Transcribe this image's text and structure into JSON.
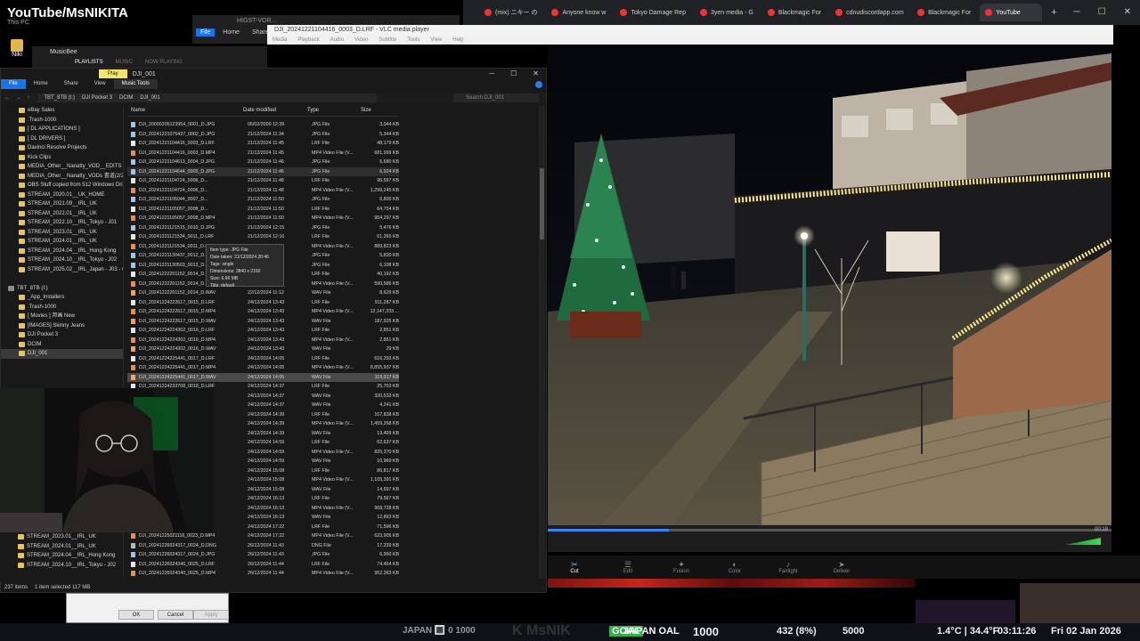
{
  "overlay": {
    "title": "YouTube/MsNIKITA",
    "this_pc": "This PC",
    "desktop_icon_label": "Niki"
  },
  "browser": {
    "tabs": [
      {
        "label": "(mix) ニキー の"
      },
      {
        "label": "Anyone know w"
      },
      {
        "label": "Tokyo Damage Rep"
      },
      {
        "label": "3yen media - G"
      },
      {
        "label": "Blackmagic For"
      },
      {
        "label": "cdnudiscordapp.com"
      },
      {
        "label": "Blackmagic For"
      },
      {
        "label": "YouTube",
        "active": true
      }
    ],
    "new_tab": "+"
  },
  "vlc": {
    "title": "DJI_20241221104416_0003_D.LRF - VLC media player",
    "menu": [
      "Media",
      "Playback",
      "Audio",
      "Video",
      "Subtitle",
      "Tools",
      "View",
      "Help"
    ],
    "time": "00:18",
    "progress": 0.215
  },
  "resolve_pages": [
    {
      "label": "Cut",
      "icon": "✂",
      "active": true
    },
    {
      "label": "Edit",
      "icon": "☰"
    },
    {
      "label": "Fusion",
      "icon": "✦"
    },
    {
      "label": "Color",
      "icon": "◐"
    },
    {
      "label": "Fairlight",
      "icon": "♪"
    },
    {
      "label": "Deliver",
      "icon": "➤"
    }
  ],
  "musicbee": {
    "title": "MusicBee",
    "tabs": [
      "PLAYLISTS",
      "MUSIC",
      "NOW PLAYING"
    ]
  },
  "bg_explorer": {
    "title": "HIGST-VOR...",
    "ribbon": [
      "File",
      "Home",
      "Share"
    ]
  },
  "explorer": {
    "play_tab": "Play",
    "title": "DJI_001",
    "ribbon": [
      "File",
      "Home",
      "Share",
      "View",
      "Music Tools"
    ],
    "path": [
      "TBT_8TB (I:)",
      "DJI Pocket 3",
      "DCIM",
      "DJI_001"
    ],
    "search_placeholder": "Search DJI_001",
    "columns": {
      "name": "Name",
      "date": "Date modified",
      "type": "Type",
      "size": "Size"
    },
    "sidebar": [
      {
        "label": "eBay Sales"
      },
      {
        "label": ".Trash-1000"
      },
      {
        "label": "[ DL APPLICATIONS ]"
      },
      {
        "label": "[ DL DRIVERS ]"
      },
      {
        "label": "Davinci Resolve Projects"
      },
      {
        "label": "Kick Clips"
      },
      {
        "label": "MEDIA_Other__Nanatty_VOD__EDITS"
      },
      {
        "label": "MEDIA_Other__Nanatty_VODs 書道(2/2"
      },
      {
        "label": "OBS Stuff copied from 512 Windows Dri"
      },
      {
        "label": "STREAM_2020.01__UK_HOME"
      },
      {
        "label": "STREAM_2021.09__IRL_UK"
      },
      {
        "label": "STREAM_2022.01__IRL_UK"
      },
      {
        "label": "STREAM_2022.10__IRL_Tokyo - J01"
      },
      {
        "label": "STREAM_2023.01__IRL_UK"
      },
      {
        "label": "STREAM_2024.01__IRL_UK"
      },
      {
        "label": "STREAM_2024.04__IRL_Hong Kong"
      },
      {
        "label": "STREAM_2024.10__IRL_Tokyo - J02"
      },
      {
        "label": "STREAM_2025.02__IRL_Japan - J03 - Co"
      },
      {
        "label": ""
      },
      {
        "label": "TBT_8TB (I:)",
        "drive": true
      },
      {
        "label": "_App_Installers"
      },
      {
        "label": ".Trash-1000"
      },
      {
        "label": "[ Movies ] 邦画 New"
      },
      {
        "label": "[IMAGES] Skinny Jeans"
      },
      {
        "label": "DJI Pocket 3"
      },
      {
        "label": "DCIM"
      },
      {
        "label": "DJI_001",
        "selected": true
      }
    ],
    "sidebar_bottom": [
      {
        "label": "STREAM_2023.01__IRL_UK"
      },
      {
        "label": "STREAM_2024.01__IRL_UK"
      },
      {
        "label": "STREAM_2024.04__IRL_Hong Kong"
      },
      {
        "label": "STREAM_2024.10__IRL_Tokyo - J02"
      }
    ],
    "files": [
      {
        "name": "DJI_20000205123954_0001_D.JPG",
        "date": "05/02/2000 12:39",
        "type": "JPG File",
        "size": "3,044 KB",
        "kind": "jpg"
      },
      {
        "name": "DJI_20241221075437_0002_D.JPG",
        "date": "21/12/2024 11:34",
        "type": "JPG File",
        "size": "5,344 KB",
        "kind": "jpg"
      },
      {
        "name": "DJI_20241221104416_0003_D.LRF",
        "date": "21/12/2024 11:45",
        "type": "LRF File",
        "size": "48,179 KB",
        "kind": "lrf"
      },
      {
        "name": "DJI_20241221104416_0003_D.MP4",
        "date": "21/12/2024 11:45",
        "type": "MP4 Video File (V...",
        "size": "681,999 KB",
        "kind": "mp4"
      },
      {
        "name": "DJI_20241221104613_0004_D.JPG",
        "date": "21/12/2024 11:46",
        "type": "JPG File",
        "size": "6,680 KB",
        "kind": "jpg"
      },
      {
        "name": "DJI_20241221104644_0005_D.JPG",
        "date": "21/12/2024 11:46",
        "type": "JPG File",
        "size": "6,924 KB",
        "kind": "jpg",
        "hover": true
      },
      {
        "name": "DJI_20241221104724_0006_D...",
        "date": "21/12/2024 11:48",
        "type": "LRF File",
        "size": "96,597 KB",
        "kind": "lrf"
      },
      {
        "name": "DJI_20241221104724_0006_D...",
        "date": "21/12/2024 11:48",
        "type": "MP4 Video File (V...",
        "size": "1,299,245 KB",
        "kind": "mp4"
      },
      {
        "name": "DJI_20241221105044_0007_D...",
        "date": "21/12/2024 11:50",
        "type": "JPG File",
        "size": "6,800 KB",
        "kind": "jpg"
      },
      {
        "name": "DJI_20241221105057_0008_D...",
        "date": "21/12/2024 11:50",
        "type": "LRF File",
        "size": "64,734 KB",
        "kind": "lrf"
      },
      {
        "name": "DJI_20241221105057_0008_D.MP4",
        "date": "21/12/2024 11:50",
        "type": "MP4 Video File (V...",
        "size": "954,297 KB",
        "kind": "mp4"
      },
      {
        "name": "DJI_20241221121515_0010_D.JPG",
        "date": "21/12/2024 12:15",
        "type": "JPG File",
        "size": "5,476 KB",
        "kind": "jpg"
      },
      {
        "name": "DJI_20241221121534_0011_D.LRF",
        "date": "21/12/2024 12:16",
        "type": "LRF File",
        "size": "61,265 KB",
        "kind": "lrf"
      },
      {
        "name": "DJI_20241221121534_0011_D.MP4",
        "date": "21/12/2024 12:16",
        "type": "MP4 Video File (V...",
        "size": "889,823 KB",
        "kind": "mp4"
      },
      {
        "name": "DJI_20241221130437_0012_D.JPG",
        "date": "21/12/2024 14:04",
        "type": "JPG File",
        "size": "5,820 KB",
        "kind": "jpg"
      },
      {
        "name": "DJI_20241221130503_0013_D.JPG",
        "date": "21/12/2024 14:05",
        "type": "JPG File",
        "size": "6,108 KB",
        "kind": "jpg"
      },
      {
        "name": "DJI_20241222201152_0014_D.LRF",
        "date": "22/12/2024 11:12",
        "type": "LRF File",
        "size": "40,192 KB",
        "kind": "lrf"
      },
      {
        "name": "DJI_20241222201152_0014_D.MP4",
        "date": "22/12/2024 11:12",
        "type": "MP4 Video File (V...",
        "size": "590,586 KB",
        "kind": "mp4"
      },
      {
        "name": "DJI_20241222201152_0014_D.WAV",
        "date": "22/12/2024 11:12",
        "type": "WAV File",
        "size": "8,629 KB",
        "kind": "wav"
      },
      {
        "name": "DJI_20241224222617_0015_D.LRF",
        "date": "24/12/2024 13:43",
        "type": "LRF File",
        "size": "911,287 KB",
        "kind": "lrf"
      },
      {
        "name": "DJI_20241224222617_0015_D.MP4",
        "date": "24/12/2024 13:43",
        "type": "MP4 Video File (V...",
        "size": "12,147,333 ...",
        "kind": "mp4"
      },
      {
        "name": "DJI_20241224222617_0015_D.WAV",
        "date": "24/12/2024 13:43",
        "type": "WAV File",
        "size": "187,925 KB",
        "kind": "wav"
      },
      {
        "name": "DJI_20241224224302_0016_D.LRF",
        "date": "24/12/2024 13:43",
        "type": "LRF File",
        "size": "2,851 KB",
        "kind": "lrf"
      },
      {
        "name": "DJI_20241224224302_0016_D.MP4",
        "date": "24/12/2024 13:43",
        "type": "MP4 Video File (V...",
        "size": "2,851 KB",
        "kind": "mp4"
      },
      {
        "name": "DJI_20241224224302_0016_D.WAV",
        "date": "24/12/2024 13:43",
        "type": "WAV File",
        "size": "29 KB",
        "kind": "wav"
      },
      {
        "name": "DJI_20241224225441_0017_D.LRF",
        "date": "24/12/2024 14:05",
        "type": "LRF File",
        "size": "616,293 KB",
        "kind": "lrf"
      },
      {
        "name": "DJI_20241224225441_0017_D.MP4",
        "date": "24/12/2024 14:05",
        "type": "MP4 Video File (V...",
        "size": "8,855,937 KB",
        "kind": "mp4"
      },
      {
        "name": "DJI_20241224225441_0017_D.WAV",
        "date": "24/12/2024 14:05",
        "type": "WAV File",
        "size": "119,917 KB",
        "kind": "wav",
        "selected": true
      },
      {
        "name": "DJI_20241224233708_0018_D.LRF",
        "date": "24/12/2024 14:37",
        "type": "LRF File",
        "size": "25,703 KB",
        "kind": "lrf"
      },
      {
        "name": "",
        "date": "24/12/2024 14:37",
        "type": "WAV File",
        "size": "320,533 KB",
        "kind": "wav"
      },
      {
        "name": "",
        "date": "24/12/2024 14:37",
        "type": "WAV File",
        "size": "4,241 KB",
        "kind": "wav"
      },
      {
        "name": "",
        "date": "24/12/2024 14:39",
        "type": "LRF File",
        "size": "107,838 KB",
        "kind": "lrf"
      },
      {
        "name": "",
        "date": "24/12/2024 14:39",
        "type": "MP4 Video File (V...",
        "size": "1,459,268 KB",
        "kind": "mp4"
      },
      {
        "name": "",
        "date": "24/12/2024 14:39",
        "type": "WAV File",
        "size": "19,409 KB",
        "kind": "wav"
      },
      {
        "name": "",
        "date": "24/12/2024 14:59",
        "type": "LRF File",
        "size": "62,637 KB",
        "kind": "lrf"
      },
      {
        "name": "",
        "date": "24/12/2024 14:59",
        "type": "MP4 Video File (V...",
        "size": "825,370 KB",
        "kind": "mp4"
      },
      {
        "name": "",
        "date": "24/12/2024 14:59",
        "type": "WAV File",
        "size": "10,969 KB",
        "kind": "wav"
      },
      {
        "name": "",
        "date": "24/12/2024 15:08",
        "type": "LRF File",
        "size": "86,817 KB",
        "kind": "lrf"
      },
      {
        "name": "",
        "date": "24/12/2024 15:08",
        "type": "MP4 Video File (V...",
        "size": "1,105,391 KB",
        "kind": "mp4"
      },
      {
        "name": "",
        "date": "24/12/2024 15:08",
        "type": "WAV File",
        "size": "14,697 KB",
        "kind": "wav"
      },
      {
        "name": "",
        "date": "24/12/2024 16:13",
        "type": "LRF File",
        "size": "79,567 KB",
        "kind": "lrf"
      },
      {
        "name": "",
        "date": "24/12/2024 16:13",
        "type": "MP4 Video File (V...",
        "size": "968,728 KB",
        "kind": "mp4"
      },
      {
        "name": "",
        "date": "24/12/2024 16:13",
        "type": "WAV File",
        "size": "12,893 KB",
        "kind": "wav"
      },
      {
        "name": "",
        "date": "24/12/2024 17:22",
        "type": "LRF File",
        "size": "71,596 KB",
        "kind": "lrf"
      },
      {
        "name": "DJI_20241225021116_0023_D.MP4",
        "date": "24/12/2024 17:22",
        "type": "MP4 Video File (V...",
        "size": "623,905 KB",
        "kind": "mp4"
      },
      {
        "name": "DJI_20241226024317_0024_D.DNG",
        "date": "26/12/2024 11:43",
        "type": "DNG File",
        "size": "17,239 KB",
        "kind": "dng"
      },
      {
        "name": "DJI_20241226024317_0024_D.JPG",
        "date": "26/12/2024 11:43",
        "type": "JPG File",
        "size": "6,960 KB",
        "kind": "jpg"
      },
      {
        "name": "DJI_20241226024340_0025_D.LRF",
        "date": "26/12/2024 11:44",
        "type": "LRF File",
        "size": "74,454 KB",
        "kind": "lrf"
      },
      {
        "name": "DJI_20241226024340_0025_D.MP4",
        "date": "26/12/2024 11:44",
        "type": "MP4 Video File (V...",
        "size": "952,363 KB",
        "kind": "mp4"
      }
    ],
    "tooltip": [
      "Item type: JPG File",
      "Date taken: 21/12/2024 20:46",
      "Tags: single",
      "Dimensions: 3840 x 2160",
      "Size: 6.66 MB",
      "Title: default"
    ],
    "status": {
      "items": "237 items",
      "selected": "1 item selected 117 MB"
    }
  },
  "dialog": {
    "ok": "OK",
    "cancel": "Cancel",
    "apply": "Apply"
  },
  "stream_bar": {
    "left": "JAPAN 🔳 0   1000",
    "kick": "K  MsNIK",
    "sub": "GOAL",
    "goal": "JAPAN   OAL",
    "count": "1000",
    "viewers": "432 (8%)",
    "points": "5000",
    "weather": "1.4°C | 34.4°F",
    "time": "03:11:26",
    "date": "Fri 02 Jan 2026"
  },
  "colors": {
    "accent": "#1a73e8",
    "progress": "#3b82f6",
    "play_tab": "#f5e36b",
    "folder": "#e7c55b"
  }
}
